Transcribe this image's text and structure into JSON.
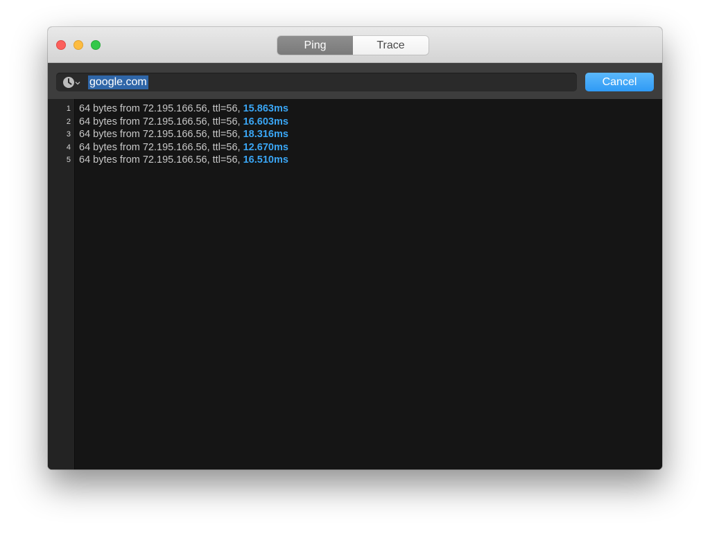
{
  "tabs": [
    {
      "label": "Ping",
      "active": true
    },
    {
      "label": "Trace",
      "active": false
    }
  ],
  "search": {
    "value": "google.com",
    "history_icon": "clock-icon"
  },
  "cancel_label": "Cancel",
  "colors": {
    "accent": "#3aa6f5",
    "console_bg": "#151515"
  },
  "results": [
    {
      "n": "1",
      "text": "64 bytes from 72.195.166.56, ttl=56,",
      "ms": "15.863ms"
    },
    {
      "n": "2",
      "text": "64 bytes from 72.195.166.56, ttl=56,",
      "ms": "16.603ms"
    },
    {
      "n": "3",
      "text": "64 bytes from 72.195.166.56, ttl=56,",
      "ms": "18.316ms"
    },
    {
      "n": "4",
      "text": "64 bytes from 72.195.166.56, ttl=56,",
      "ms": "12.670ms"
    },
    {
      "n": "5",
      "text": "64 bytes from 72.195.166.56, ttl=56,",
      "ms": "16.510ms"
    }
  ]
}
